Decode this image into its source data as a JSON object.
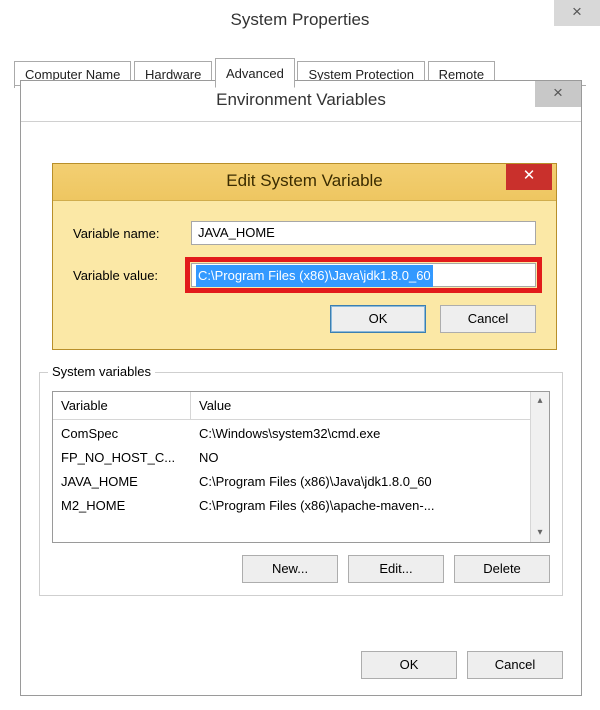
{
  "sysprops": {
    "title": "System Properties",
    "close_glyph": "×",
    "tabs": [
      {
        "label": "Computer Name",
        "active": false
      },
      {
        "label": "Hardware",
        "active": false
      },
      {
        "label": "Advanced",
        "active": true
      },
      {
        "label": "System Protection",
        "active": false
      },
      {
        "label": "Remote",
        "active": false
      }
    ]
  },
  "envvars": {
    "title": "Environment Variables",
    "close_glyph": "×",
    "system_group_label": "System variables",
    "col_variable": "Variable",
    "col_value": "Value",
    "rows": [
      {
        "name": "ComSpec",
        "value": "C:\\Windows\\system32\\cmd.exe"
      },
      {
        "name": "FP_NO_HOST_C...",
        "value": "NO"
      },
      {
        "name": "JAVA_HOME",
        "value": "C:\\Program Files (x86)\\Java\\jdk1.8.0_60"
      },
      {
        "name": "M2_HOME",
        "value": "C:\\Program Files (x86)\\apache-maven-..."
      }
    ],
    "btn_new": "New...",
    "btn_edit": "Edit...",
    "btn_delete": "Delete",
    "btn_ok": "OK",
    "btn_cancel": "Cancel",
    "scroll_up": "▴",
    "scroll_down": "▾"
  },
  "editdlg": {
    "title": "Edit System Variable",
    "close_glyph": "✕",
    "label_name": "Variable name:",
    "label_value": "Variable value:",
    "field_name": "JAVA_HOME",
    "field_value": "C:\\Program Files (x86)\\Java\\jdk1.8.0_60",
    "btn_ok": "OK",
    "btn_cancel": "Cancel"
  }
}
